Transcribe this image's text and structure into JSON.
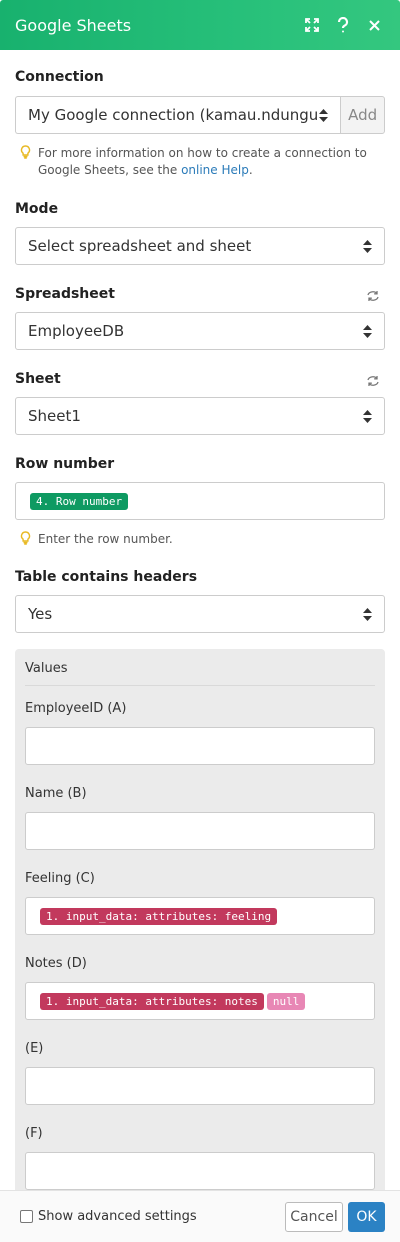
{
  "header": {
    "title": "Google Sheets",
    "icons": [
      "expand-icon",
      "help-icon",
      "close-icon"
    ]
  },
  "connection": {
    "label": "Connection",
    "value": "My Google connection (kamau.ndungu",
    "add_label": "Add",
    "hint_text": "For more information on how to create a connection to Google Sheets, see the",
    "hint_link": "online Help",
    "hint_end": "."
  },
  "mode": {
    "label": "Mode",
    "value": "Select spreadsheet and sheet"
  },
  "spreadsheet": {
    "label": "Spreadsheet",
    "value": "EmployeeDB"
  },
  "sheet": {
    "label": "Sheet",
    "value": "Sheet1"
  },
  "row_number": {
    "label": "Row number",
    "pill": "4. Row number",
    "hint": "Enter the row number."
  },
  "headers": {
    "label": "Table contains headers",
    "value": "Yes"
  },
  "values": {
    "title": "Values",
    "fields": [
      {
        "label": "EmployeeID (A)",
        "pills": []
      },
      {
        "label": "Name (B)",
        "pills": []
      },
      {
        "label": "Feeling (C)",
        "pills": [
          "1. input_data: attributes: feeling"
        ]
      },
      {
        "label": "Notes (D)",
        "pills": [
          "1. input_data: attributes: notes",
          "null"
        ]
      },
      {
        "label": "(E)",
        "pills": []
      },
      {
        "label": "(F)",
        "pills": []
      }
    ]
  },
  "footer": {
    "advanced_label": "Show advanced settings",
    "cancel_label": "Cancel",
    "ok_label": "OK"
  },
  "colors": {
    "header_green": "#1db772",
    "pill_green": "#0e9a62",
    "pill_red": "#c2395d",
    "pill_pink": "#e887b5",
    "ok_blue": "#2b82c4"
  }
}
